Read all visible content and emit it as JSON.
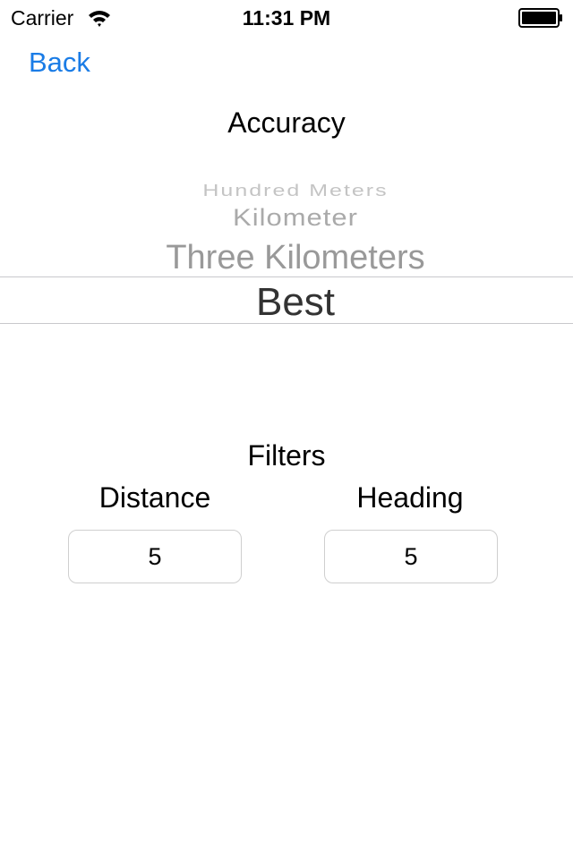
{
  "status_bar": {
    "carrier": "Carrier",
    "time": "11:31 PM",
    "wifi_icon": "wifi-icon",
    "battery_icon": "battery-icon"
  },
  "nav": {
    "back_label": "Back",
    "accent_color": "#1a7ce6"
  },
  "accuracy": {
    "title": "Accuracy",
    "picker_options": [
      "Hundred Meters",
      "Kilometer",
      "Three Kilometers",
      "Best"
    ],
    "selected": "Best"
  },
  "filters": {
    "title": "Filters",
    "distance": {
      "label": "Distance",
      "value": "5"
    },
    "heading": {
      "label": "Heading",
      "value": "5"
    }
  }
}
